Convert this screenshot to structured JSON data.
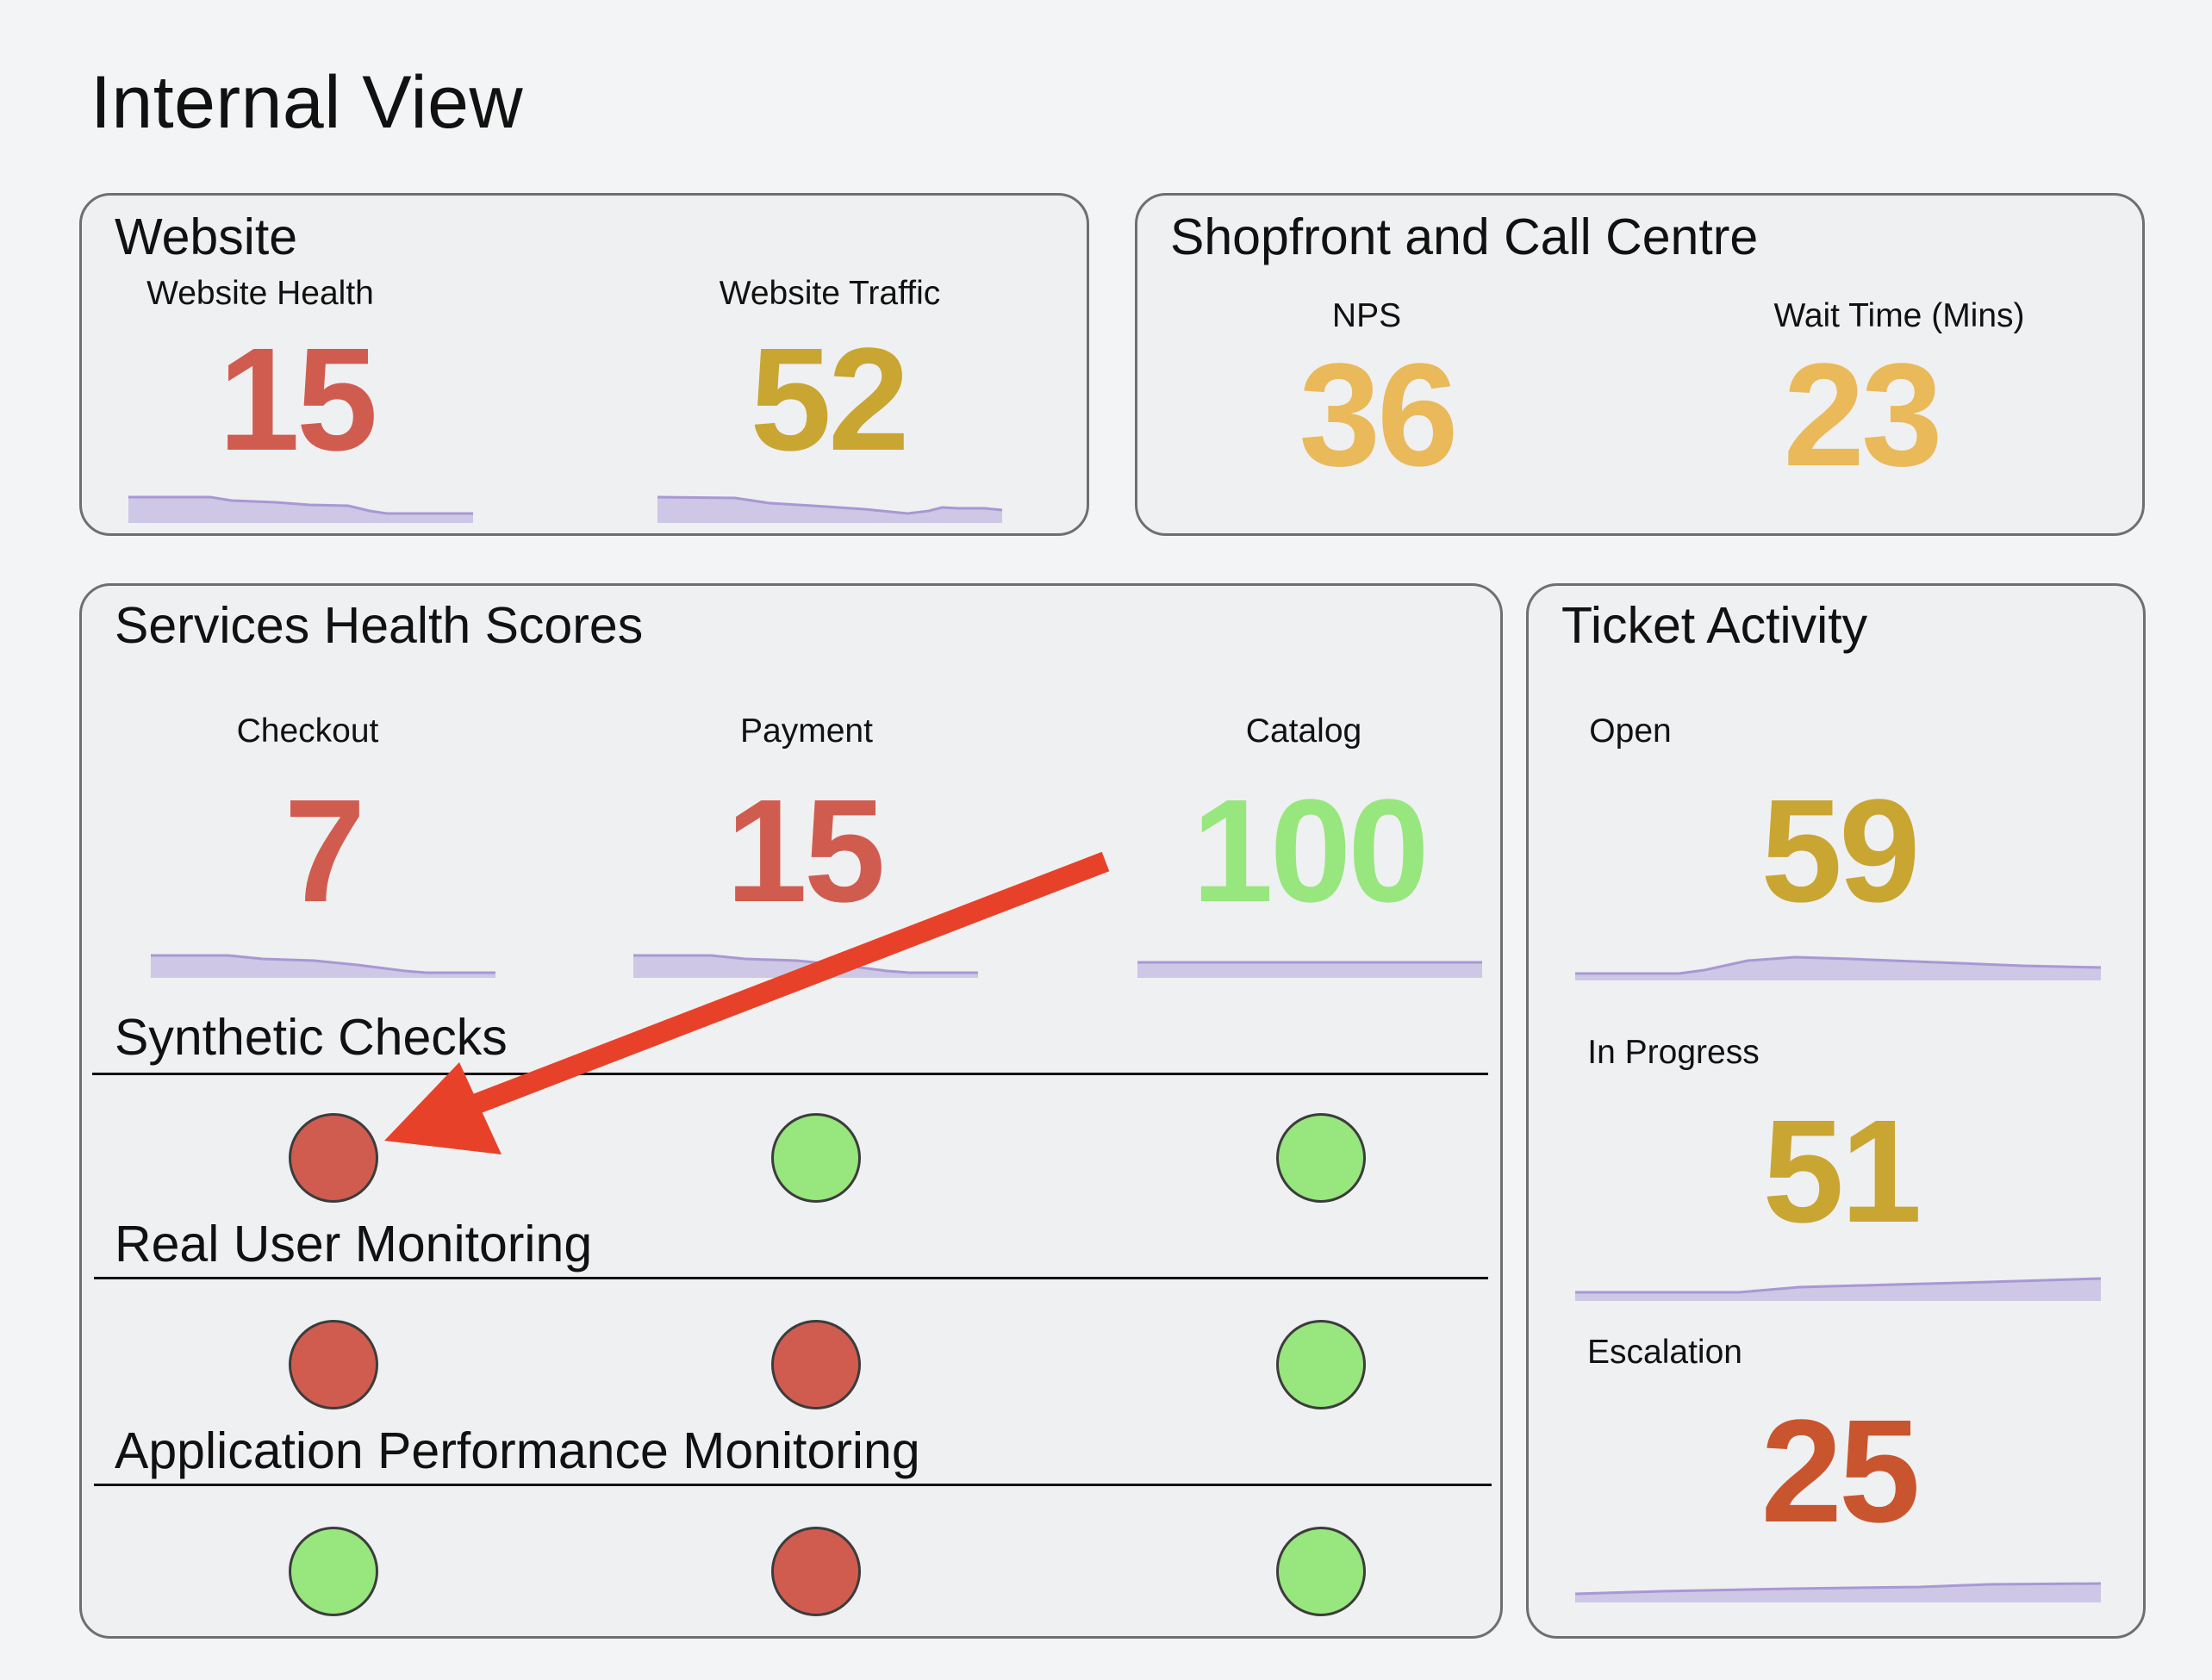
{
  "page_title": "Internal View",
  "colors": {
    "red": "#d05c50",
    "gold": "#c9a532",
    "amber": "#eab95a",
    "green": "#98e67e",
    "orange_red": "#c9552f",
    "sparkline": "#b3a6dc",
    "arrow": "#e8412a"
  },
  "website": {
    "title": "Website",
    "health": {
      "label": "Website Health",
      "value": "15"
    },
    "traffic": {
      "label": "Website Traffic",
      "value": "52"
    }
  },
  "shopfront": {
    "title": "Shopfront and Call Centre",
    "nps": {
      "label": "NPS",
      "value": "36"
    },
    "wait": {
      "label": "Wait Time (Mins)",
      "value": "23"
    }
  },
  "services": {
    "title": "Services Health Scores",
    "checkout": {
      "label": "Checkout",
      "value": "7"
    },
    "payment": {
      "label": "Payment",
      "value": "15"
    },
    "catalog": {
      "label": "Catalog",
      "value": "100"
    },
    "sections": [
      {
        "title": "Synthetic Checks",
        "statuses": [
          "red",
          "green",
          "green"
        ]
      },
      {
        "title": "Real User Monitoring",
        "statuses": [
          "red",
          "red",
          "green"
        ]
      },
      {
        "title": "Application Performance Monitoring",
        "statuses": [
          "green",
          "red",
          "green"
        ]
      }
    ]
  },
  "tickets": {
    "title": "Ticket Activity",
    "open": {
      "label": "Open",
      "value": "59"
    },
    "in_progress": {
      "label": "In Progress",
      "value": "51"
    },
    "escalation": {
      "label": "Escalation",
      "value": "25"
    }
  }
}
